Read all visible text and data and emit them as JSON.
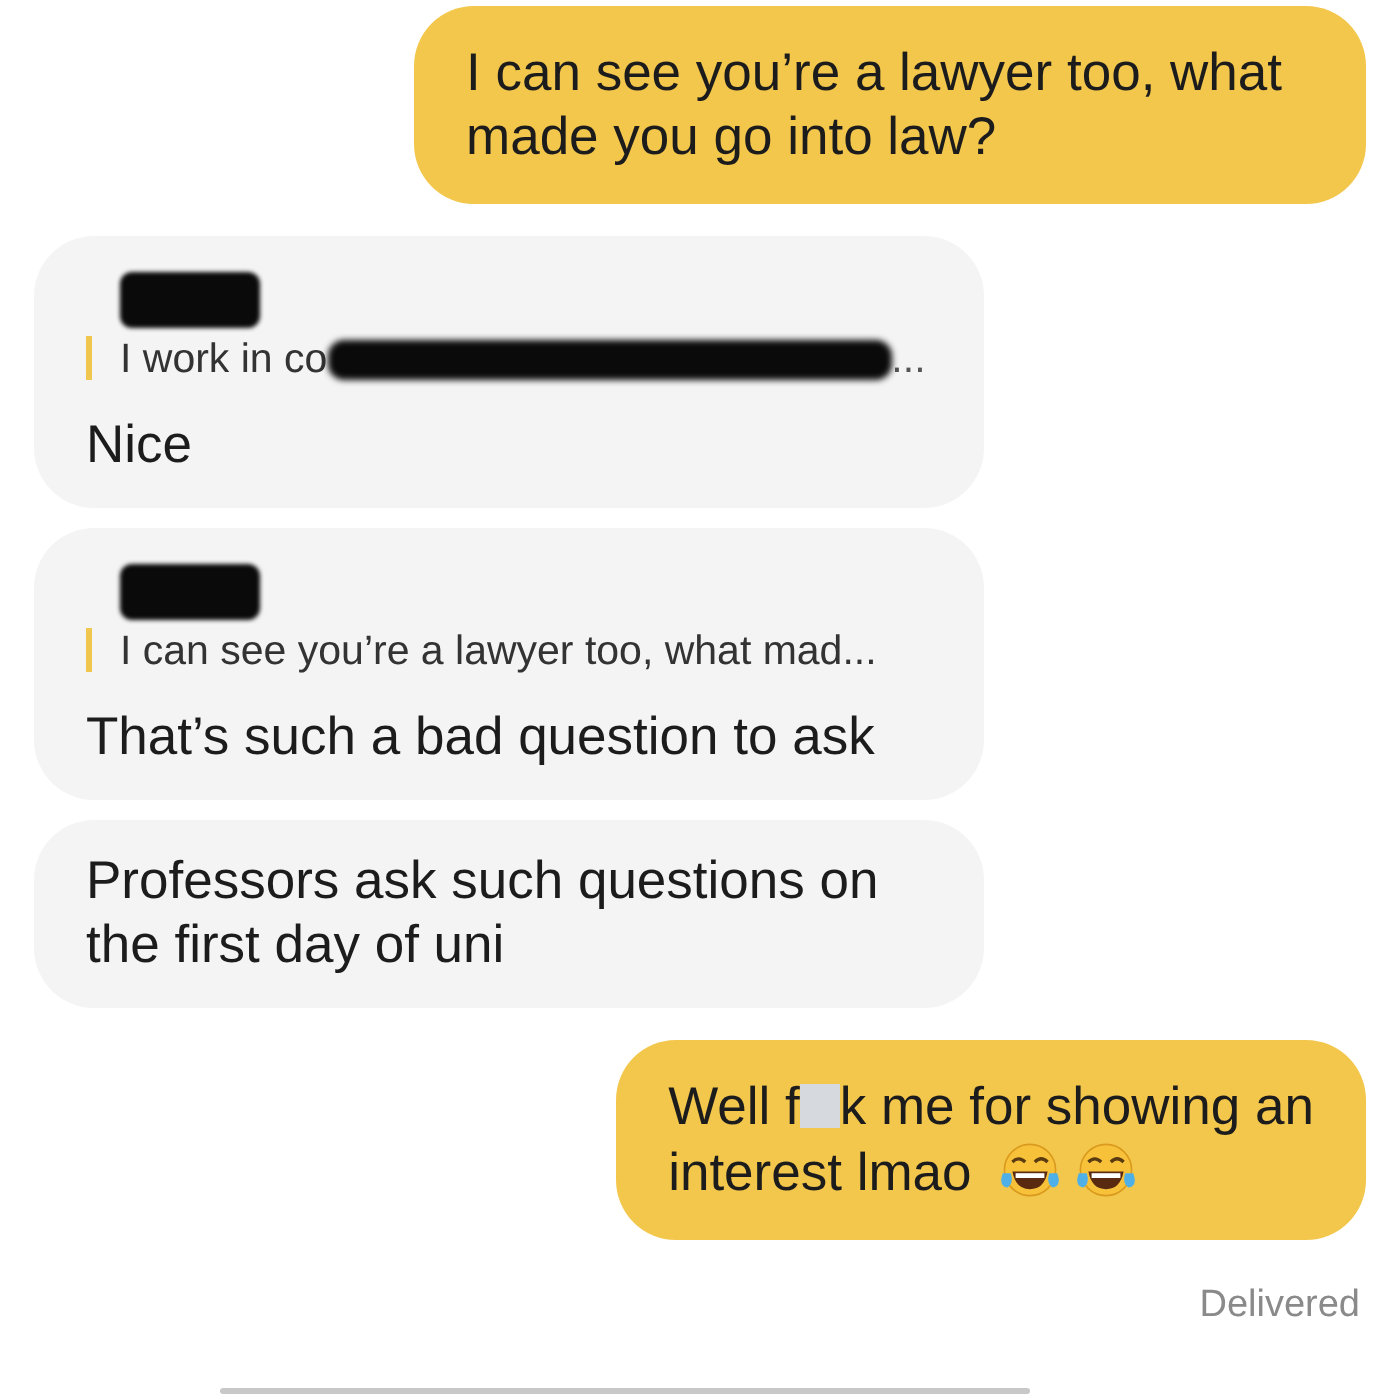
{
  "messages": [
    {
      "kind": "outgoing",
      "text": "I can see you’re a lawyer too, what made you go into law?"
    },
    {
      "kind": "incoming",
      "reply": {
        "sender_redacted": true,
        "quote": "I work in co",
        "quote_redacted": true,
        "quote_end": "..."
      },
      "text": "Nice"
    },
    {
      "kind": "incoming",
      "reply": {
        "sender_redacted": true,
        "quote": "I can see you’re a lawyer too, what mad...",
        "quote_redacted": false
      },
      "text": "That’s such a bad question to ask"
    },
    {
      "kind": "incoming",
      "text": "Professors ask such questions on the first day of uni"
    },
    {
      "kind": "outgoing",
      "text_before": "Well f",
      "censored": true,
      "text": "k me for showing an",
      "text_line2": "interest lmao",
      "emoji": [
        {
          "kind": "tears-of-joy"
        },
        {
          "kind": "tears-of-joy"
        }
      ]
    }
  ],
  "status": "Delivered"
}
